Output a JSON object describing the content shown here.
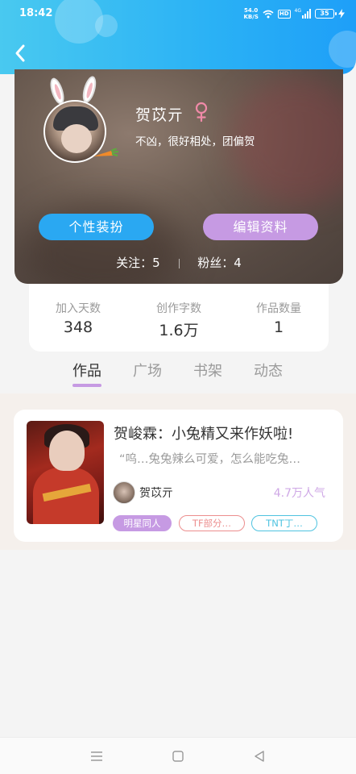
{
  "status_bar": {
    "time": "18:42",
    "net_speed_value": "54.0",
    "net_speed_unit": "KB/S",
    "hd_badge": "HD",
    "signal_label": "4G",
    "battery": "35",
    "icons": [
      "wifi-icon",
      "hd-icon",
      "signal-icon",
      "battery-icon",
      "charging-icon"
    ]
  },
  "header": {
    "back_icon": "chevron-left-icon",
    "colors": {
      "start": "#49c9f0",
      "end": "#1e9ff8"
    }
  },
  "profile": {
    "username": "贺苡亓",
    "gender_icon": "female-icon",
    "bio": "不凶，很好相处，团偏贺",
    "buttons": {
      "dress_up": "个性装扮",
      "edit_profile": "编辑资料"
    },
    "follow": {
      "following_label": "关注：",
      "following_count": "5",
      "fans_label": "粉丝：",
      "fans_count": "4"
    }
  },
  "stats": [
    {
      "label": "加入天数",
      "value": "348"
    },
    {
      "label": "创作字数",
      "value": "1.6万"
    },
    {
      "label": "作品数量",
      "value": "1"
    }
  ],
  "tabs": [
    {
      "label": "作品",
      "active": true
    },
    {
      "label": "广场",
      "active": false
    },
    {
      "label": "书架",
      "active": false
    },
    {
      "label": "动态",
      "active": false
    }
  ],
  "works": [
    {
      "title": "贺峻霖：小兔精又来作妖啦!",
      "description": "“呜…兔兔辣么可爱，怎么能吃兔…",
      "author": "贺苡亓",
      "popularity": "4.7万人气",
      "tags": [
        "明星同人",
        "TF部分…",
        "TNT丁…"
      ]
    }
  ],
  "nav": {
    "menu_icon": "menu-icon",
    "home_icon": "home-square-icon",
    "back_icon": "back-triangle-icon"
  },
  "colors": {
    "accent_blue": "#2aa8f2",
    "accent_purple": "#c69ae3",
    "tag_red": "#ec8e8e",
    "tag_cyan": "#4fc3e0"
  }
}
